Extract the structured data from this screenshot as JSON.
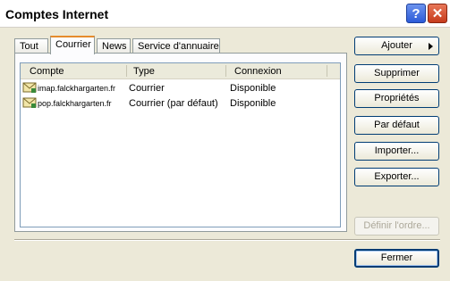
{
  "window": {
    "title": "Comptes Internet"
  },
  "tabs": [
    {
      "label": "Tout"
    },
    {
      "label": "Courrier"
    },
    {
      "label": "News"
    },
    {
      "label": "Service d'annuaire"
    }
  ],
  "list": {
    "columns": [
      "Compte",
      "Type",
      "Connexion"
    ],
    "rows": [
      {
        "account": "imap.falckhargarten.fr",
        "type": "Courrier",
        "status": "Disponible"
      },
      {
        "account": "pop.falckhargarten.fr",
        "type": "Courrier (par défaut)",
        "status": "Disponible"
      }
    ]
  },
  "buttons": {
    "add": "Ajouter",
    "remove": "Supprimer",
    "properties": "Propriétés",
    "set_default": "Par défaut",
    "import": "Importer...",
    "export": "Exporter...",
    "set_order": "Définir l'ordre...",
    "close": "Fermer"
  }
}
